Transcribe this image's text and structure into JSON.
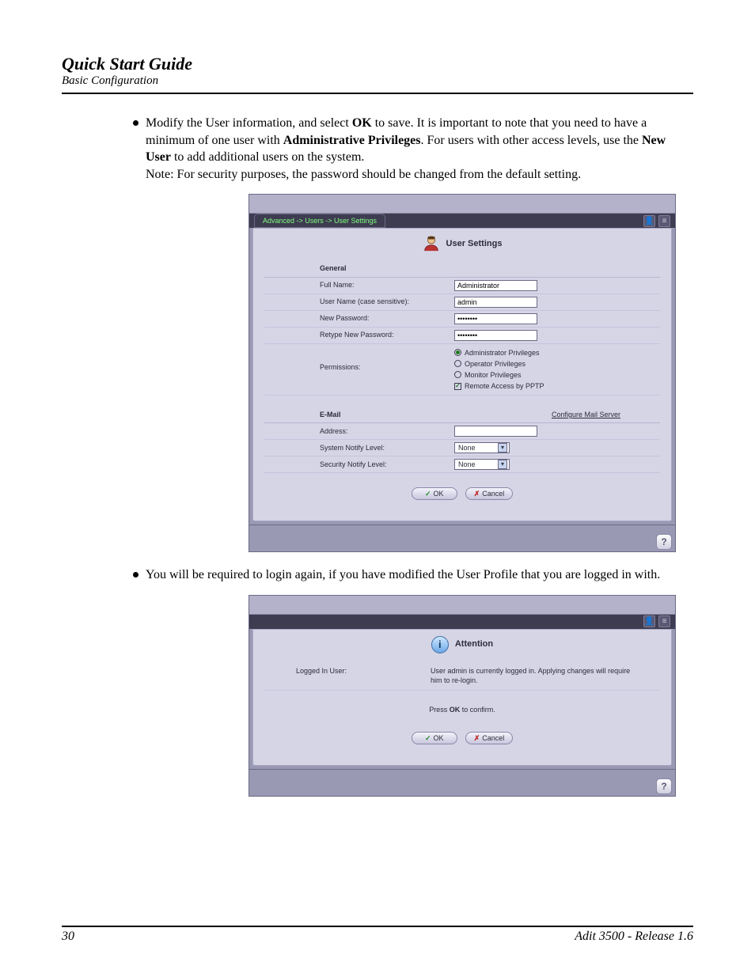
{
  "header": {
    "title": "Quick Start Guide",
    "subtitle": "Basic Configuration"
  },
  "bullets": {
    "b1_pre": "Modify the User information, and select ",
    "b1_ok": "OK",
    "b1_mid1": " to save. It is important to note that you need to have a minimum of one user with ",
    "b1_admin": "Administrative Privileges",
    "b1_mid2": ". For users with other access levels, use the ",
    "b1_newuser": "New User",
    "b1_post": " to add additional users on the system.",
    "b1_note": "Note: For security purposes, the password should be changed from the default setting.",
    "b2": "You will be required to login again, if you have modified the User Profile that you are logged in with."
  },
  "app1": {
    "breadcrumb": "Advanced -> Users -> User Settings",
    "title": "User Settings",
    "section_general": "General",
    "labels": {
      "full_name": "Full Name:",
      "user_name": "User Name (case sensitive):",
      "new_password": "New Password:",
      "retype_password": "Retype New Password:",
      "permissions": "Permissions:"
    },
    "values": {
      "full_name": "Administrator",
      "user_name": "admin",
      "new_password": "••••••••",
      "retype_password": "••••••••"
    },
    "permissions": {
      "admin": "Administrator Privileges",
      "operator": "Operator Privileges",
      "monitor": "Monitor Privileges",
      "remote": "Remote Access by PPTP"
    },
    "section_email": "E-Mail",
    "configure_mail": "Configure Mail Server",
    "email_labels": {
      "address": "Address:",
      "system_notify": "System Notify Level:",
      "security_notify": "Security Notify Level:"
    },
    "email_values": {
      "address": "",
      "system_notify": "None",
      "security_notify": "None"
    },
    "buttons": {
      "ok": "OK",
      "cancel": "Cancel"
    }
  },
  "app2": {
    "title": "Attention",
    "label": "Logged In User:",
    "message": "User admin is currently logged in. Applying changes will require him to re-login.",
    "confirm_pre": "Press ",
    "confirm_b": "OK",
    "confirm_post": " to confirm.",
    "buttons": {
      "ok": "OK",
      "cancel": "Cancel"
    }
  },
  "footer": {
    "page": "30",
    "product": "Adit 3500  - Release 1.6"
  }
}
